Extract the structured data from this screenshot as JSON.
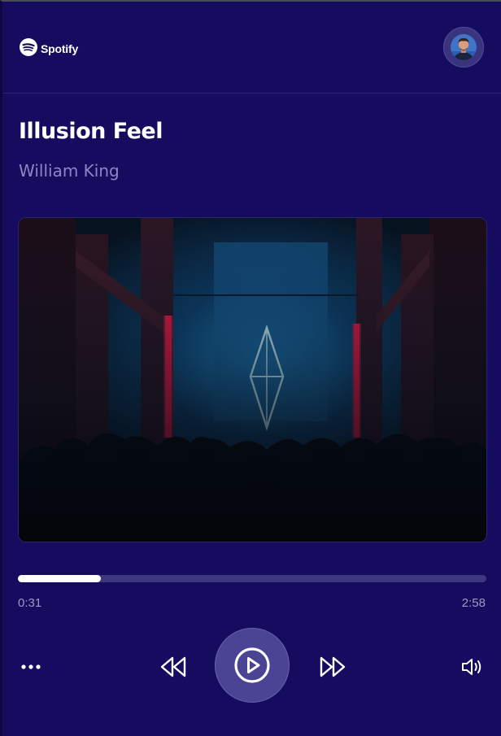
{
  "app": {
    "logo_text": "Spotify",
    "logo_icon": "spotify-icon",
    "avatar_icon": "user-avatar",
    "colors": {
      "background": "#150c5f",
      "accent": "#ffffff",
      "muted_text": "#8c86c2",
      "progress_track": "#3d3680",
      "play_button": "#4b4394"
    }
  },
  "track": {
    "title": "Illusion Feel",
    "artist": "William King"
  },
  "player": {
    "elapsed": "0:31",
    "duration": "2:58",
    "progress_fraction": 0.177
  },
  "controls": {
    "more": "more-options-icon",
    "rewind": "rewind-icon",
    "play": "play-icon",
    "forward": "fast-forward-icon",
    "volume": "volume-icon"
  }
}
